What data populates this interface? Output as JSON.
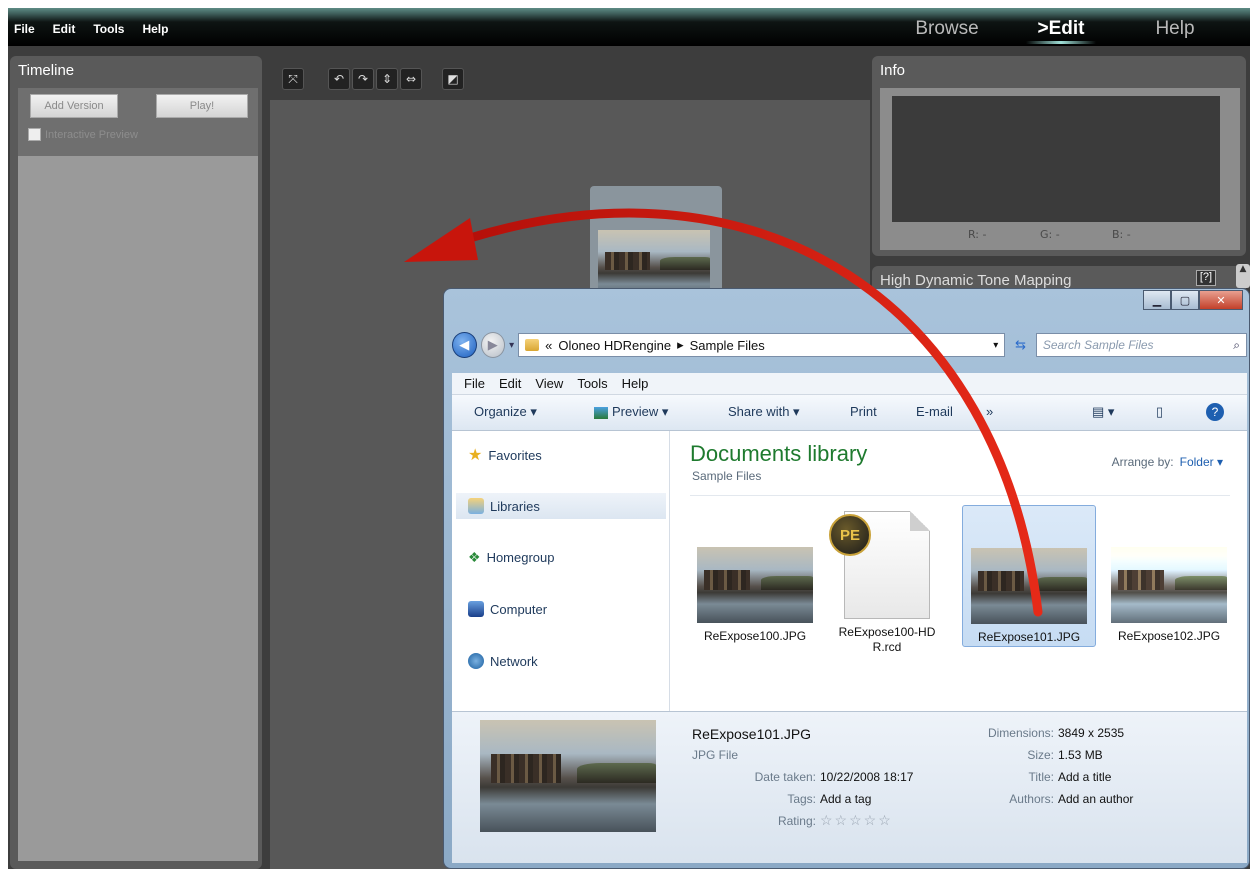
{
  "app": {
    "menu": [
      "File",
      "Edit",
      "Tools",
      "Help"
    ],
    "modes": [
      "Browse",
      ">Edit",
      "Help"
    ]
  },
  "timeline": {
    "title": "Timeline",
    "add_version": "Add Version",
    "play": "Play!",
    "interactive_preview": "Interactive Preview"
  },
  "info": {
    "title": "Info",
    "r": "R: -",
    "g": "G: -",
    "b": "B: -"
  },
  "hdtm": {
    "title": "High Dynamic Tone Mapping",
    "help": "[?]"
  },
  "explorer": {
    "address": {
      "prefix": "«",
      "path_1": "Oloneo HDRengine",
      "sep": "▸",
      "path_2": "Sample Files"
    },
    "search_placeholder": "Search Sample Files",
    "menu": [
      "File",
      "Edit",
      "View",
      "Tools",
      "Help"
    ],
    "commands": {
      "organize": "Organize ▾",
      "preview": "Preview ▾",
      "share": "Share with ▾",
      "print": "Print",
      "email": "E-mail",
      "more": "»"
    },
    "nav": {
      "favorites": "Favorites",
      "libraries": "Libraries",
      "homegroup": "Homegroup",
      "computer": "Computer",
      "network": "Network"
    },
    "library": {
      "title": "Documents library",
      "subtitle": "Sample Files",
      "arrange_label": "Arrange by:",
      "arrange_value": "Folder ▾"
    },
    "files": [
      {
        "name": "ReExpose100.JPG"
      },
      {
        "name": "ReExpose100-HDR.rcd",
        "line1": "ReExpose100-HD",
        "line2": "R.rcd"
      },
      {
        "name": "ReExpose101.JPG"
      },
      {
        "name": "ReExpose102.JPG"
      }
    ],
    "details": {
      "filename": "ReExpose101.JPG",
      "filetype": "JPG File",
      "date_label": "Date taken:",
      "date_value": "10/22/2008 18:17",
      "tags_label": "Tags:",
      "tags_value": "Add a tag",
      "rating_label": "Rating:",
      "rating_stars": "☆☆☆☆☆",
      "dimensions_label": "Dimensions:",
      "dimensions_value": "3849 x 2535",
      "size_label": "Size:",
      "size_value": "1.53 MB",
      "title_label": "Title:",
      "title_value": "Add a title",
      "authors_label": "Authors:",
      "authors_value": "Add an author"
    }
  },
  "colors": {
    "arrow": "#d4190f",
    "library_title": "#1e7a2e"
  }
}
